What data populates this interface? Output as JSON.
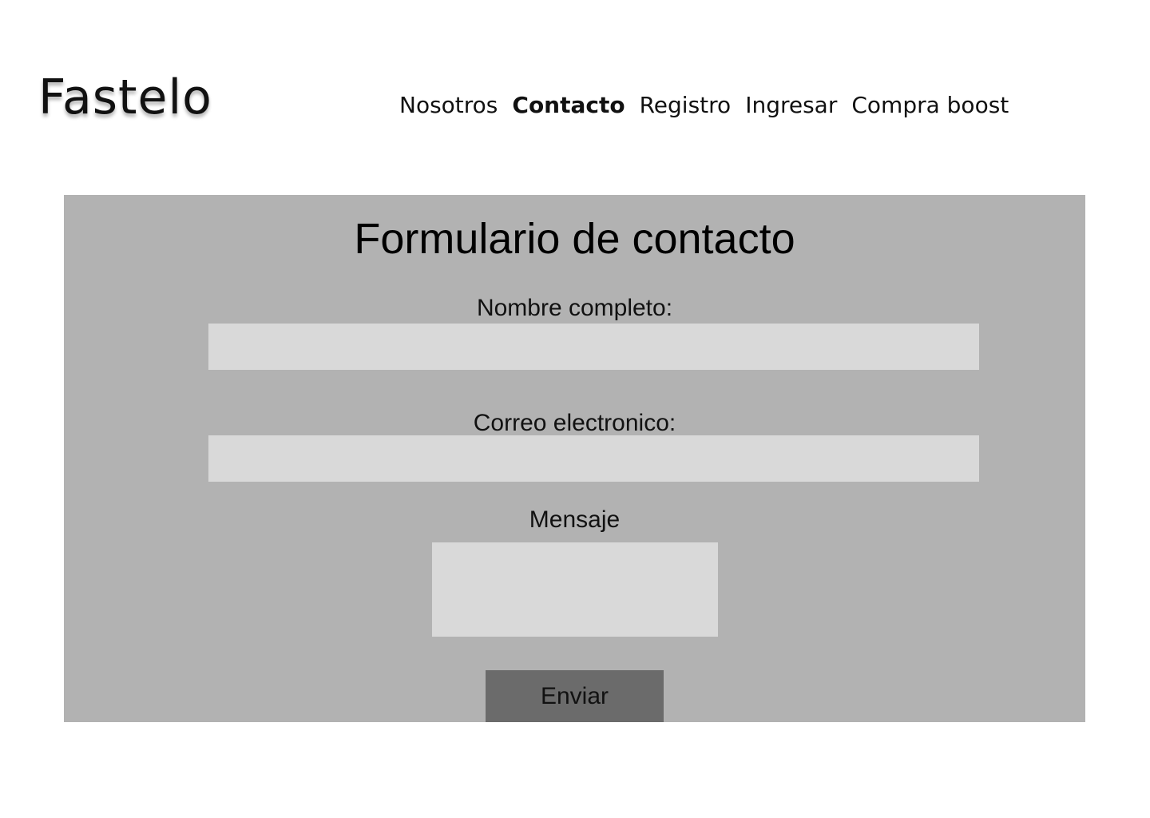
{
  "header": {
    "logo": "Fastelo",
    "nav": [
      {
        "label": "Nosotros",
        "active": false
      },
      {
        "label": "Contacto",
        "active": true
      },
      {
        "label": "Registro",
        "active": false
      },
      {
        "label": "Ingresar",
        "active": false
      },
      {
        "label": "Compra boost",
        "active": false
      }
    ]
  },
  "form": {
    "title": "Formulario de contacto",
    "name": {
      "label": "Nombre completo:",
      "value": "",
      "placeholder": ""
    },
    "email": {
      "label": "Correo electronico:",
      "value": "",
      "placeholder": ""
    },
    "message": {
      "label": "Mensaje",
      "value": "",
      "placeholder": ""
    },
    "submit_label": "Enviar"
  },
  "colors": {
    "panel_background": "#b2b2b2",
    "input_background": "#d9d9d9",
    "button_background": "#6b6b6b",
    "page_background": "#ffffff"
  }
}
